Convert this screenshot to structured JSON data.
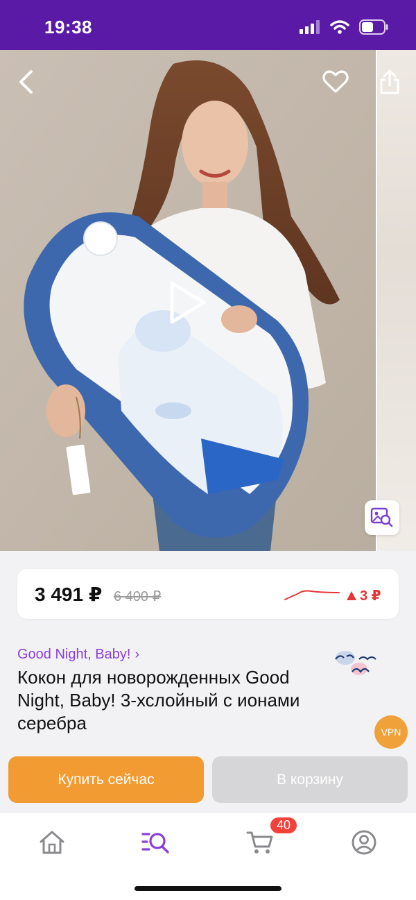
{
  "status": {
    "time": "19:38"
  },
  "product": {
    "price_current": "3 491 ₽",
    "price_old": "6 400 ₽",
    "price_change": "3 ₽",
    "brand": "Good Night, Baby!",
    "brand_chevron": "›",
    "title": "Кокон для новорожденных Good Night, Baby! 3-хслойный с ионами серебра"
  },
  "actions": {
    "buy_now": "Купить сейчас",
    "add_to_cart": "В корзину"
  },
  "badges": {
    "vpn": "VPN",
    "cart_count": "40"
  },
  "colors": {
    "status_bar": "#5a1aa6",
    "accent_purple": "#8b3fd9",
    "buy_orange": "#f29b32",
    "price_up_red": "#e53535"
  },
  "icons": {
    "back": "chevron-left-icon",
    "favorite": "heart-icon",
    "share": "share-icon",
    "play": "play-icon",
    "visual_search": "image-search-icon",
    "home": "home-icon",
    "catalog": "catalog-search-icon",
    "cart": "cart-icon",
    "profile": "profile-icon"
  }
}
